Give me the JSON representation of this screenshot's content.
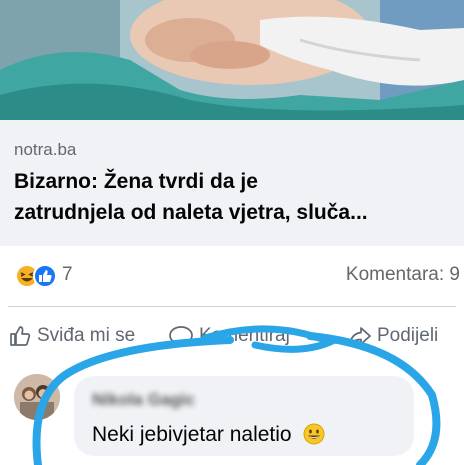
{
  "link_preview": {
    "domain": "notra.ba",
    "title_line1": "Bizarno: Žena tvrdi da je",
    "title_line2": "zatrudnjela od naleta vjetra, sluča..."
  },
  "stats": {
    "reaction_count": "7",
    "comments_label": "Komentara: 9",
    "reaction_icons": [
      "haha-reaction-icon",
      "like-reaction-icon"
    ]
  },
  "actions": {
    "like_label": "Sviđa mi se",
    "comment_label": "Komentiraj",
    "share_label": "Podijeli"
  },
  "comment": {
    "author": "Nikola Gagic",
    "text": "Neki jebivjetar naletio",
    "emoji": "grinning-face-icon"
  },
  "colors": {
    "scribble": "#2aa6e8",
    "link_preview_bg": "#f0f2f5",
    "secondary_text": "#65676b",
    "like_blue": "#1877f2",
    "haha_yellow": "#f7b125"
  }
}
